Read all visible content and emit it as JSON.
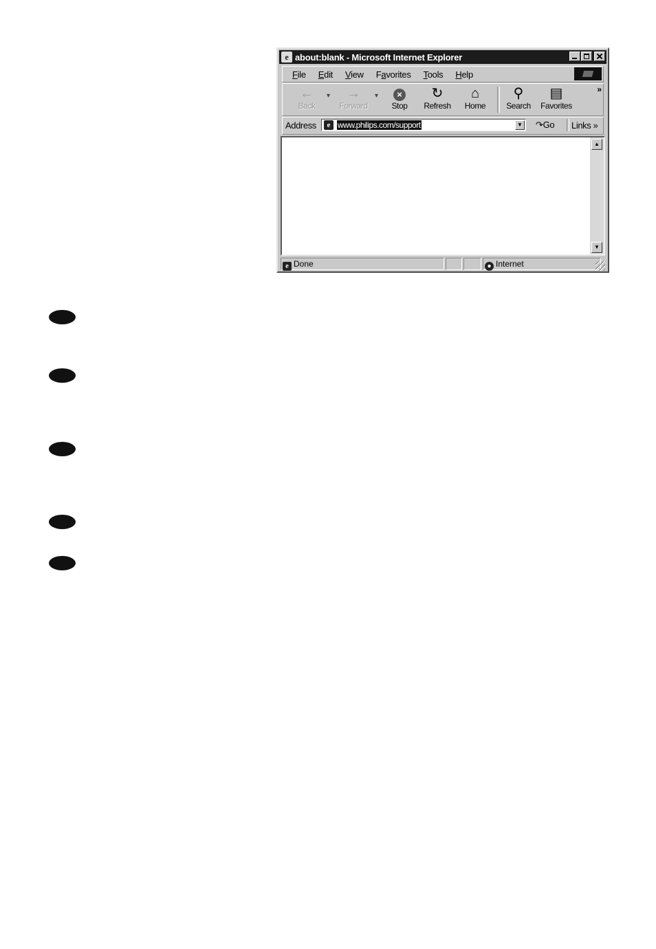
{
  "window": {
    "title": "about:blank - Microsoft Internet Explorer",
    "title_icon": "ie-icon"
  },
  "menu": [
    "File",
    "Edit",
    "View",
    "Favorites",
    "Tools",
    "Help"
  ],
  "menu_mnemonics": [
    "F",
    "E",
    "V",
    "a",
    "T",
    "H"
  ],
  "toolbar": {
    "back": "Back",
    "forward": "Forward",
    "stop": "Stop",
    "refresh": "Refresh",
    "home": "Home",
    "search": "Search",
    "favorites": "Favorites",
    "more": "»"
  },
  "address": {
    "label": "Address",
    "value": "www.philips.com/support",
    "go": "Go",
    "links": "Links »"
  },
  "status": {
    "text": "Done",
    "zone": "Internet"
  },
  "page": {
    "bullet_count": 5
  }
}
